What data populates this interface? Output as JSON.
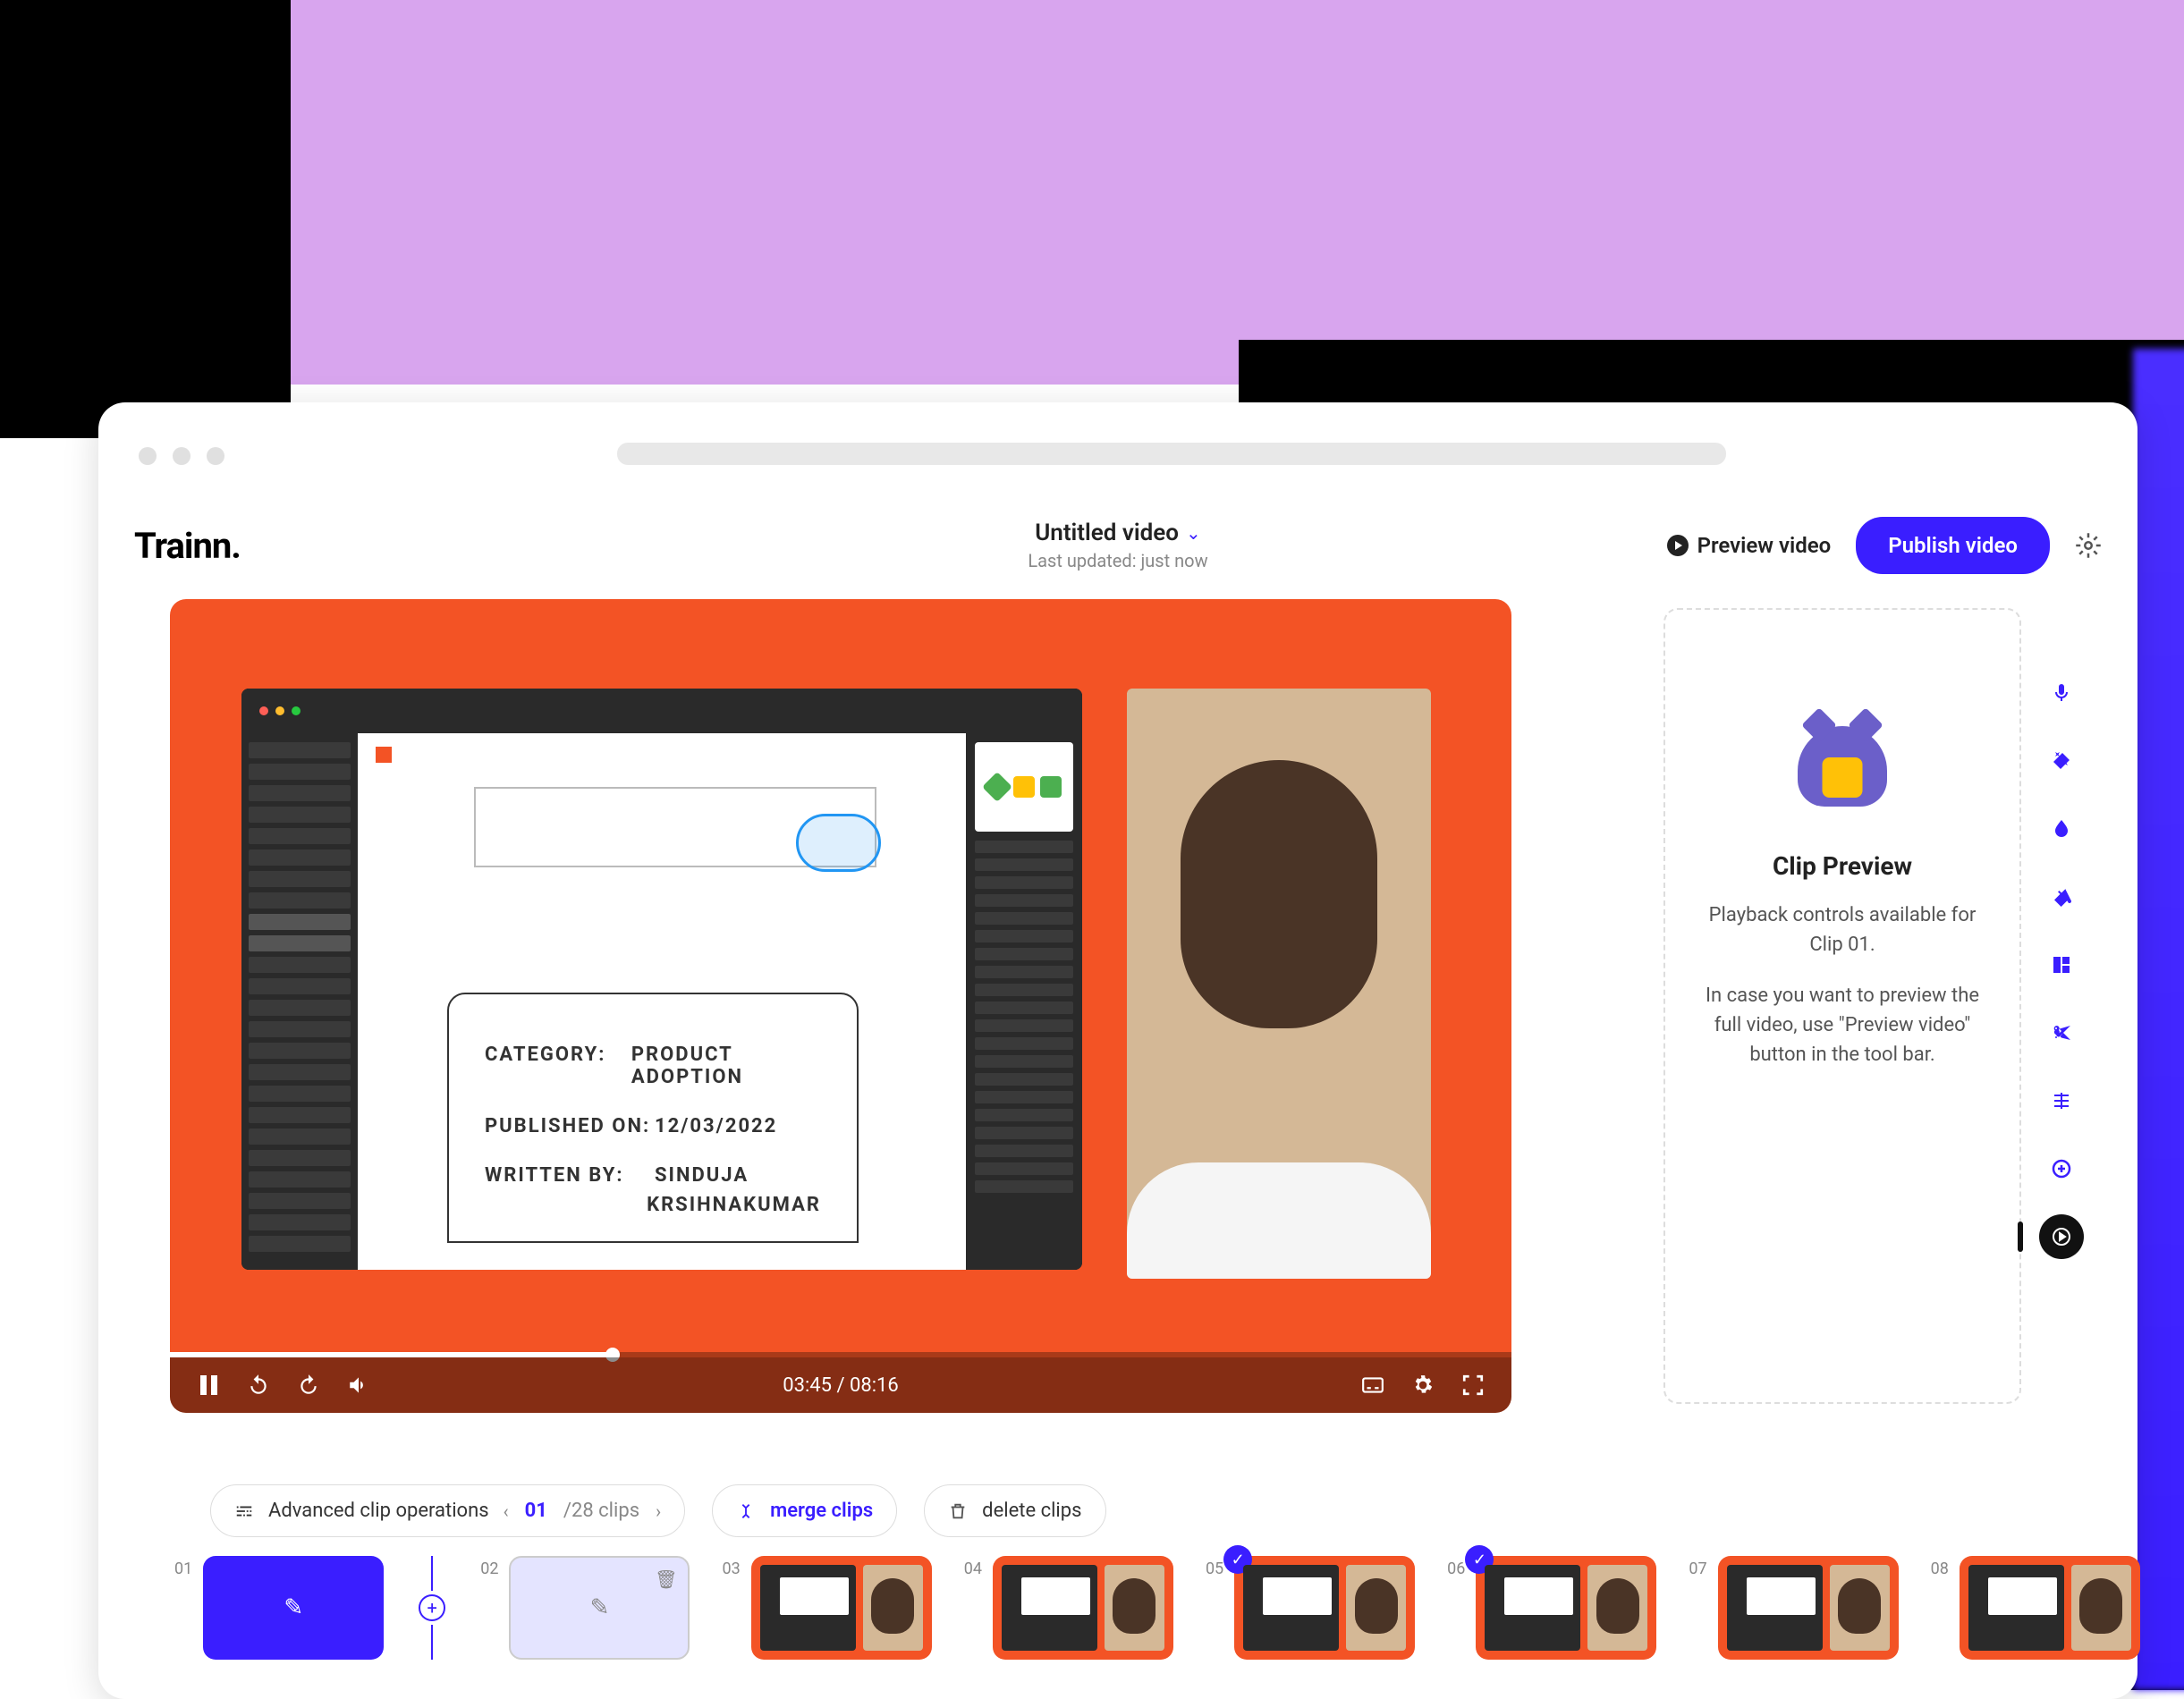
{
  "header": {
    "logo": "Trainn",
    "title": "Untitled video",
    "updated": "Last updated: just now",
    "preview": "Preview video",
    "publish": "Publish video"
  },
  "video_content": {
    "category_label": "CATEGORY:",
    "category_value": "PRODUCT ADOPTION",
    "published_label": "PUBLISHED ON:",
    "published_value": "12/03/2022",
    "written_label": "WRITTEN BY:",
    "written_value_1": "SINDUJA",
    "written_value_2": "KRSIHNAKUMAR"
  },
  "player": {
    "time": "03:45 / 08:16"
  },
  "clip_panel": {
    "title": "Clip Preview",
    "text1": "Playback controls available for Clip 01.",
    "text2": "In case you want to preview the full video, use \"Preview video\" button in the tool bar."
  },
  "bottom": {
    "advanced": "Advanced clip operations",
    "current": "01",
    "total": "/28 clips",
    "merge": "merge clips",
    "delete": "delete clips"
  },
  "clips": {
    "n1": "01",
    "n2": "02",
    "n3": "03",
    "n4": "04",
    "n5": "05",
    "n6": "06",
    "n7": "07",
    "n8": "08"
  }
}
